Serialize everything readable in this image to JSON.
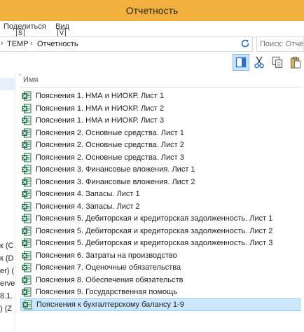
{
  "window": {
    "title": "Отчетность"
  },
  "ribbon": {
    "share_tab": "Поделиться",
    "share_key": "S",
    "view_tab": "Вид",
    "view_key": "V"
  },
  "address": {
    "crumbs": [
      "TEMP",
      "Отчетность"
    ],
    "separator": "›"
  },
  "search": {
    "placeholder": "Поиск: Отчетн"
  },
  "column": {
    "name_header": "Имя"
  },
  "nav_fragments": [
    "к (C",
    "к (D",
    "er) (",
    "erve",
    "8.1.",
    ") (Z"
  ],
  "files": [
    {
      "name": "Пояснения 1. НМА и НИОКР. Лист 1"
    },
    {
      "name": "Пояснения 1. НМА и НИОКР. Лист 2"
    },
    {
      "name": "Пояснения 1. НМА и НИОКР. Лист 3"
    },
    {
      "name": "Пояснения 2. Основные средства. Лист 1"
    },
    {
      "name": "Пояснения 2. Основные средства. Лист 2"
    },
    {
      "name": "Пояснения 2. Основные средства. Лист 3"
    },
    {
      "name": "Пояснения 3. Финансовые вложения. Лист 1"
    },
    {
      "name": "Пояснения 3. Финансовые вложения. Лист 2"
    },
    {
      "name": "Пояснения 4. Запасы. Лист 1"
    },
    {
      "name": "Пояснения 4. Запасы. Лист 2"
    },
    {
      "name": "Пояснения 5. Дебиторская и кредиторская задолженность. Лист 1"
    },
    {
      "name": "Пояснения 5. Дебиторская и кредиторская задолженность. Лист 2"
    },
    {
      "name": "Пояснения 5. Дебиторская и кредиторская задолженность. Лист 3"
    },
    {
      "name": "Пояснения 6. Затраты на производство"
    },
    {
      "name": "Пояснения 7. Оценочные обязательства"
    },
    {
      "name": "Пояснения 8. Обеспечения обязательств"
    },
    {
      "name": "Пояснения 9. Государственная помощь"
    },
    {
      "name": "Пояснения к бухгалтерскому балансу 1-9",
      "selected": true
    }
  ],
  "colors": {
    "titlebar": "#f2b03f",
    "selection": "#cce8ff",
    "excel_green": "#1e7145"
  }
}
